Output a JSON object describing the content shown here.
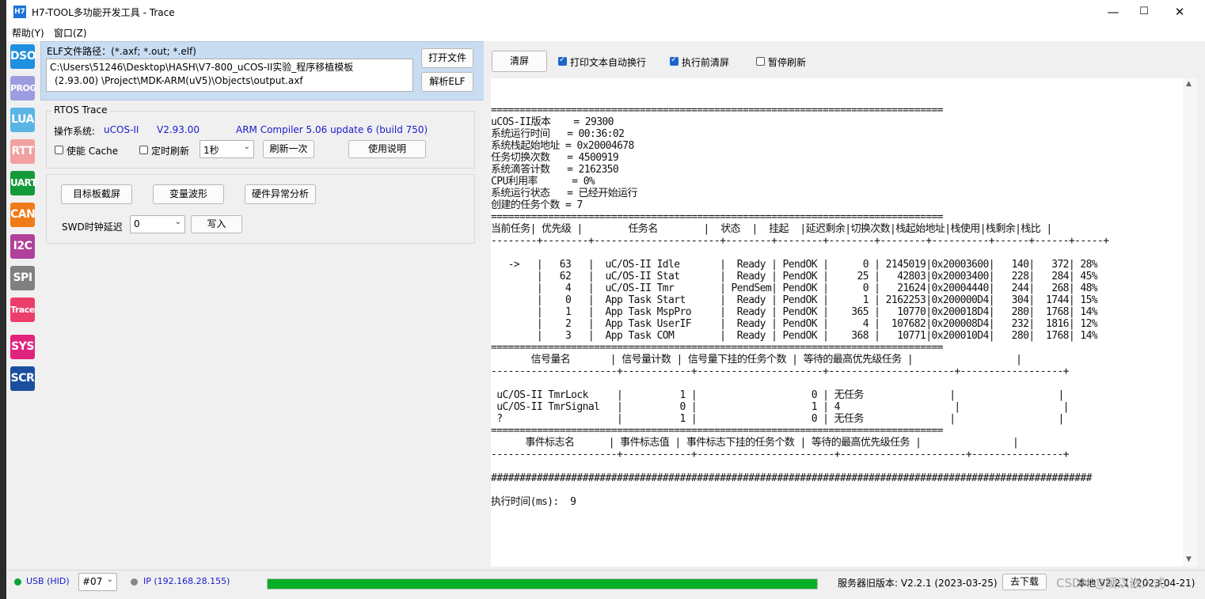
{
  "window": {
    "title": "H7-TOOL多功能开发工具 - Trace",
    "icon_text": "H7",
    "controls": {
      "minimize": "—",
      "maximize": "☐",
      "close": "✕"
    }
  },
  "menu": [
    "帮助(Y)",
    "窗口(Z)"
  ],
  "sidebar": [
    {
      "label": "DSO",
      "color": "#1f8fe0"
    },
    {
      "label": "PROG",
      "color": "#9c9ce0"
    },
    {
      "label": "LUA",
      "color": "#5ab4e6"
    },
    {
      "label": "RTT",
      "color": "#f2a0a0"
    },
    {
      "label": "UART",
      "color": "#159a3a"
    },
    {
      "label": "CAN",
      "color": "#f07b1a"
    },
    {
      "label": "I2C",
      "color": "#b0409a"
    },
    {
      "label": "SPI",
      "color": "#808080"
    },
    {
      "label": "Trace",
      "color": "#ec3e6a"
    },
    {
      "label": "SYS",
      "color": "#e0247e"
    },
    {
      "label": "SCR",
      "color": "#1a4fa0"
    }
  ],
  "elf": {
    "label": "ELF文件路径：(*.axf; *.out; *.elf)",
    "path_line1": "C:\\Users\\51246\\Desktop\\HASH\\V7-800_uCOS-II实验_程序移植模板",
    "path_line2": "(2.93.00)  \\Project\\MDK-ARM(uV5)\\Objects\\output.axf",
    "open_button": "打开文件",
    "parse_button": "解析ELF"
  },
  "rtos": {
    "group_title": "RTOS Trace",
    "os_label": "操作系统:",
    "os_name": "uCOS-II",
    "os_version": "V2.93.00",
    "compiler": "ARM Compiler 5.06 update 6 (build 750)",
    "cache_label": "使能 Cache",
    "timer_label": "定时刷新",
    "interval_value": "1秒",
    "refresh_button": "刷新一次",
    "help_button": "使用说明"
  },
  "tools": {
    "screenshot_button": "目标板截屏",
    "waveform_button": "变量波形",
    "fault_button": "硬件异常分析",
    "swd_label": "SWD时钟延迟",
    "swd_value": "0",
    "write_button": "写入"
  },
  "right_toolbar": {
    "clear_button": "清屏",
    "wrap_label": "打印文本自动换行",
    "wrap_checked": true,
    "clear_before_label": "执行前清屏",
    "clear_before_checked": true,
    "pause_label": "暂停刷新",
    "pause_checked": false
  },
  "terminal": [
    "===============================================================================",
    "uCOS-II版本    = 29300",
    "系统运行时间   = 00:36:02",
    "系统栈起始地址 = 0x20004678",
    "任务切换次数   = 4500919",
    "系统滴答计数   = 2162350",
    "CPU利用率      = 0%",
    "系统运行状态   = 已经开始运行",
    "创建的任务个数 = 7",
    "===============================================================================",
    "当前任务| 优先级 |        任务名        |  状态  |  挂起  |延迟剩余|切换次数|栈起始地址|栈使用|栈剩余|栈比 |",
    "--------+--------+----------------------+--------+--------+--------+--------+----------+------+------+-----+",
    "",
    "   ->   |   63   |  uC/OS-II Idle       |  Ready | PendOK |      0 | 2145019|0x20003600|   140|   372| 28% ",
    "        |   62   |  uC/OS-II Stat       |  Ready | PendOK |     25 |   42803|0x20003400|   228|   284| 45% ",
    "        |    4   |  uC/OS-II Tmr        | PendSem| PendOK |      0 |   21624|0x20004440|   244|   268| 48% ",
    "        |    0   |  App Task Start      |  Ready | PendOK |      1 | 2162253|0x200000D4|   304|  1744| 15% ",
    "        |    1   |  App Task MspPro     |  Ready | PendOK |    365 |   10770|0x200018D4|   280|  1768| 14% ",
    "        |    2   |  App Task UserIF     |  Ready | PendOK |      4 |  107682|0x200008D4|   232|  1816| 12% ",
    "        |    3   |  App Task COM        |  Ready | PendOK |    368 |   10771|0x200010D4|   280|  1768| 14% ",
    "===============================================================================",
    "       信号量名       | 信号量计数 | 信号量下挂的任务个数 | 等待的最高优先级任务 |                  |",
    "----------------------+------------+----------------------+----------------------+------------------+",
    "",
    " uC/OS-II TmrLock     |          1 |                    0 | 无任务               |                  |",
    " uC/OS-II TmrSignal   |          0 |                    1 | 4                    |                  |",
    " ?                    |          1 |                    0 | 无任务               |                  |",
    "===============================================================================",
    "      事件标志名      | 事件标志值 | 事件标志下挂的任务个数 | 等待的最高优先级任务 |                |",
    "----------------------+------------+------------------------+----------------------+----------------+",
    "",
    "#########################################################################################################",
    "",
    "执行时间(ms):  9"
  ],
  "status": {
    "usb_label": "USB (HID)",
    "usb_color": "#0aa33a",
    "device_value": "#07",
    "ip_label": "IP (192.168.28.155)",
    "ip_color": "#888888",
    "progress": 1.0,
    "progress_color": "#06b025",
    "server_version": "服务器旧版本: V2.2.1 (2023-03-25)",
    "download_button": "去下载",
    "local_version": "本地 V2.2.1 (2023-04-21)",
    "watermark": "CSDN @硬汉嵌入式"
  }
}
